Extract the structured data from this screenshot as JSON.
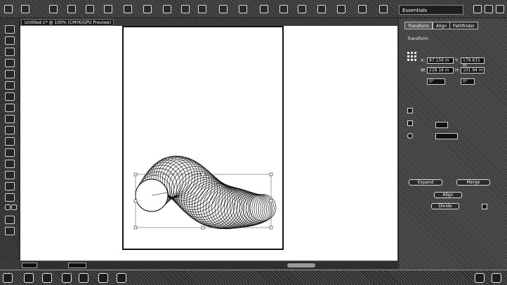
{
  "app": {
    "workspace": "Essentials"
  },
  "document": {
    "tab_title": "Untitled-1* @ 100% (CMYK/GPU Preview)"
  },
  "panel": {
    "tabs": [
      "Transform",
      "Align",
      "Pathfinder"
    ],
    "section": "Transform",
    "fields": {
      "x": "87.156 m",
      "y": "179.631 m",
      "w": "228.16 m",
      "h": "101.94 m",
      "angle": "0°",
      "shear": "0°"
    },
    "buttons": [
      "Expand",
      "Merge",
      "Align",
      "Divide"
    ]
  }
}
